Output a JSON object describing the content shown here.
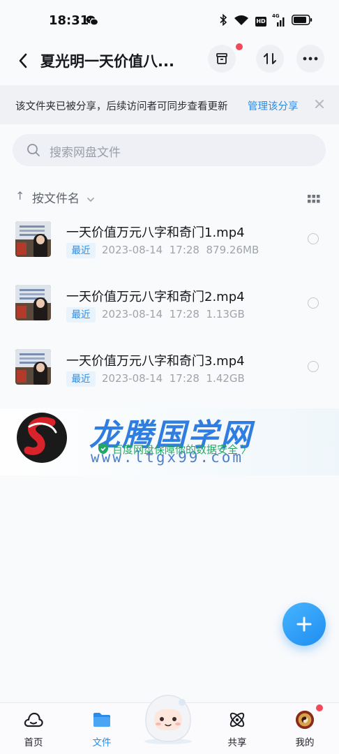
{
  "status_bar": {
    "time": "18:31",
    "icons": [
      "wechat-icon",
      "bluetooth-icon",
      "wifi-icon",
      "hd-icon",
      "signal-4g-icon",
      "battery-icon"
    ],
    "hd_label": "HD",
    "network_label": "4G"
  },
  "nav": {
    "title": "夏光明一天价值八...",
    "icons": [
      "back-icon",
      "archive-icon",
      "sort-transfer-icon",
      "more-icon"
    ]
  },
  "share_banner": {
    "text": "该文件夹已被分享，后续访问者可同步查看更新",
    "link": "管理该分享"
  },
  "search": {
    "placeholder": "搜索网盘文件"
  },
  "sort": {
    "arrow": "↑",
    "label": "按文件名"
  },
  "files": [
    {
      "name": "一天价值万元八字和奇门1.mp4",
      "tag": "最近",
      "date": "2023-08-14",
      "time": "17:28",
      "size": "879.26MB"
    },
    {
      "name": "一天价值万元八字和奇门2.mp4",
      "tag": "最近",
      "date": "2023-08-14",
      "time": "17:28",
      "size": "1.13GB"
    },
    {
      "name": "一天价值万元八字和奇门3.mp4",
      "tag": "最近",
      "date": "2023-08-14",
      "time": "17:28",
      "size": "1.42GB"
    }
  ],
  "watermark": {
    "title": "龙腾国学网",
    "secure_text": "百度网盘保障你的数据安全 〉",
    "url": "www.ltgx99.com"
  },
  "tabs": [
    {
      "label": "首页",
      "icon": "home-cloud-icon",
      "active": false
    },
    {
      "label": "文件",
      "icon": "folder-icon",
      "active": true
    },
    {
      "label": "共享",
      "icon": "share-atom-icon",
      "active": false
    },
    {
      "label": "我的",
      "icon": "avatar-icon",
      "active": false
    }
  ],
  "colors": {
    "accent": "#2a8ce8",
    "tag_bg": "#e8f3fc",
    "notification": "#f04a5b",
    "watermark_blue": "#2f7de0",
    "secure_green": "#22a864"
  }
}
